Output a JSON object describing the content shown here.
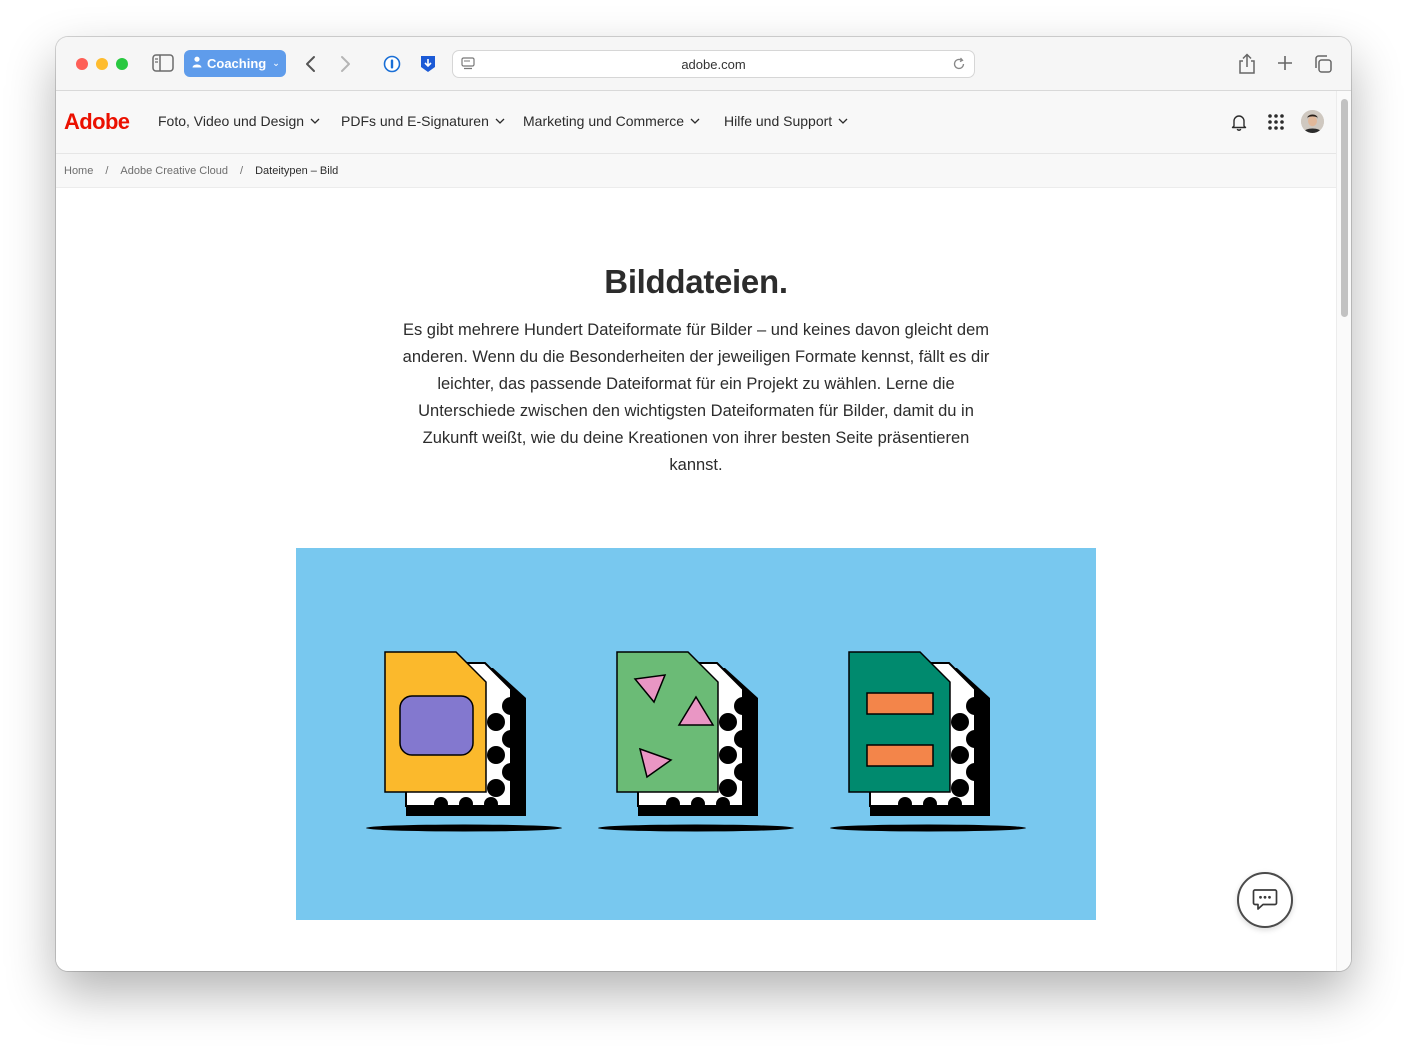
{
  "browser": {
    "profile_name": "Coaching",
    "url": "adobe.com"
  },
  "site": {
    "logo_text": "Adobe",
    "nav": [
      {
        "label": "Foto, Video und Design"
      },
      {
        "label": "PDFs und E-Signaturen"
      },
      {
        "label": "Marketing und Commerce"
      },
      {
        "label": "Hilfe und Support"
      }
    ],
    "breadcrumb": [
      "Home",
      "Adobe Creative Cloud",
      "Dateitypen – Bild"
    ],
    "title": "Bilddateien.",
    "intro": "Es gibt mehrere Hundert Dateiformate für Bilder – und keines davon gleicht dem anderen. Wenn du die Besonderheiten der jeweiligen Formate kennst, fällt es dir leichter, das passende Dateiformat für ein Projekt zu wählen. Lerne die Unterschiede zwischen den wichtigsten Dateiformaten für Bilder, damit du in Zukunft weißt, wie du deine Kreationen von ihrer besten Seite präsentieren kannst."
  },
  "colors": {
    "adobe_red": "#eb1000",
    "hero_bg": "#78c8ef",
    "file1": "#fbb92c",
    "file1_inner": "#8378cf",
    "file2": "#6bbb76",
    "file2_inner": "#e996c4",
    "file3": "#008a6e",
    "file3_inner": "#f3854a",
    "profile_pill": "#5f9ceb"
  }
}
